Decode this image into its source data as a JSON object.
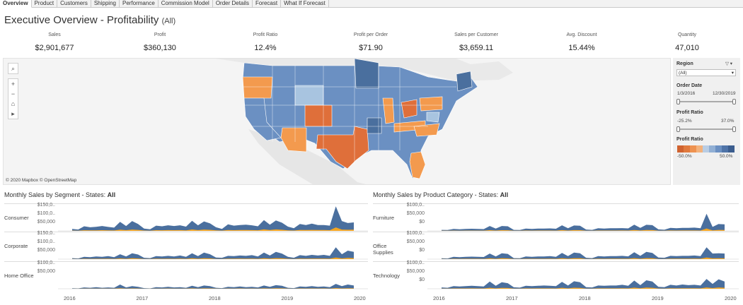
{
  "tabs": [
    {
      "label": "Overview",
      "active": true
    },
    {
      "label": "Product"
    },
    {
      "label": "Customers"
    },
    {
      "label": "Shipping"
    },
    {
      "label": "Performance"
    },
    {
      "label": "Commission Model"
    },
    {
      "label": "Order Details"
    },
    {
      "label": "Forecast"
    },
    {
      "label": "What If Forecast"
    }
  ],
  "title": "Executive Overview - Profitability",
  "title_filter": "(All)",
  "kpis": [
    {
      "label": "Sales",
      "value": "$2,901,677"
    },
    {
      "label": "Profit",
      "value": "$360,130"
    },
    {
      "label": "Profit Ratio",
      "value": "12.4%"
    },
    {
      "label": "Profit per Order",
      "value": "$71.90"
    },
    {
      "label": "Sales per Customer",
      "value": "$3,659.11"
    },
    {
      "label": "Avg. Discount",
      "value": "15.44%"
    },
    {
      "label": "Quantity",
      "value": "47,010"
    }
  ],
  "map": {
    "attribution": "© 2020 Mapbox  © OpenStreetMap",
    "controls": [
      "search-icon",
      "zoom-in-icon",
      "zoom-out-icon",
      "home-icon",
      "play-icon"
    ],
    "colors": {
      "blue_dark": "#4a6f9e",
      "blue": "#6b90c2",
      "blue_light": "#a8c4e0",
      "orange": "#f39a4e",
      "orange_dark": "#df6f3a"
    }
  },
  "filters": {
    "region_label": "Region",
    "region_value": "(All)",
    "order_date_label": "Order Date",
    "order_date_start": "1/3/2016",
    "order_date_end": "12/30/2019",
    "profit_ratio_label": "Profit Ratio",
    "profit_ratio_min": "-25.2%",
    "profit_ratio_max": "37.0%",
    "legend_label": "Profit Ratio",
    "legend_min": "-50.0%",
    "legend_max": "50.0%",
    "legend_colors": [
      "#d0622f",
      "#e07a3e",
      "#ee9250",
      "#f3b27c",
      "#b9cde4",
      "#91afd4",
      "#6b90c2",
      "#4f74a8",
      "#3b5d8e"
    ]
  },
  "charts": {
    "left_title": "Monthly Sales by Segment - States: ",
    "left_title_bold": "All",
    "right_title": "Monthly Sales by Product Category - States: ",
    "right_title_bold": "All",
    "sales_color": "#4a6f9e",
    "profit_color": "#f5a623",
    "years": [
      "2016",
      "2017",
      "2018",
      "2019",
      "2020"
    ],
    "left_rows": [
      {
        "label": "Consumer",
        "ticks": [
          "$150,0..",
          "$100,0..",
          "$50,000"
        ]
      },
      {
        "label": "Corporate",
        "ticks": [
          "$150,0..",
          "$100,0..",
          "$50,000"
        ]
      },
      {
        "label": "Home Office",
        "ticks": [
          "$100,0..",
          "$50,000"
        ]
      }
    ],
    "right_rows": [
      {
        "label": "Furniture",
        "ticks": [
          "$100,0..",
          "$50,000",
          "$0"
        ]
      },
      {
        "label": "Office Supplies",
        "ticks": [
          "$100,0..",
          "$50,000",
          "$0"
        ]
      },
      {
        "label": "Technology",
        "ticks": [
          "$100,0..",
          "$50,000",
          "$0"
        ]
      }
    ]
  },
  "chart_data": [
    {
      "type": "area",
      "title": "Monthly Sales by Segment - States: All",
      "x": [
        "2016",
        "2016",
        "2016",
        "2016",
        "2016",
        "2016",
        "2016",
        "2016",
        "2016",
        "2016",
        "2016",
        "2016",
        "2017",
        "2017",
        "2017",
        "2017",
        "2017",
        "2017",
        "2017",
        "2017",
        "2017",
        "2017",
        "2017",
        "2017",
        "2018",
        "2018",
        "2018",
        "2018",
        "2018",
        "2018",
        "2018",
        "2018",
        "2018",
        "2018",
        "2018",
        "2018",
        "2019",
        "2019",
        "2019",
        "2019",
        "2019",
        "2019",
        "2019",
        "2019",
        "2019",
        "2019",
        "2019",
        "2019"
      ],
      "series": [
        {
          "name": "Consumer",
          "values": [
            12000,
            8000,
            28000,
            22000,
            25000,
            30000,
            24000,
            20000,
            55000,
            30000,
            60000,
            42000,
            14000,
            10000,
            32000,
            28000,
            34000,
            30000,
            34000,
            26000,
            62000,
            34000,
            58000,
            46000,
            22000,
            12000,
            40000,
            32000,
            36000,
            38000,
            34000,
            28000,
            66000,
            38000,
            64000,
            50000,
            26000,
            16000,
            42000,
            36000,
            44000,
            36000,
            36000,
            32000,
            150000,
            60000,
            48000,
            52000
          ]
        },
        {
          "name": "Corporate",
          "values": [
            6000,
            4000,
            14000,
            12000,
            16000,
            14000,
            18000,
            12000,
            30000,
            16000,
            36000,
            28000,
            8000,
            6000,
            18000,
            16000,
            20000,
            16000,
            22000,
            14000,
            36000,
            18000,
            40000,
            30000,
            10000,
            8000,
            20000,
            18000,
            22000,
            20000,
            24000,
            16000,
            40000,
            22000,
            44000,
            34000,
            14000,
            8000,
            24000,
            20000,
            26000,
            22000,
            26000,
            20000,
            72000,
            30000,
            52000,
            44000
          ]
        },
        {
          "name": "Home Office",
          "values": [
            3000,
            2000,
            8000,
            6000,
            10000,
            6000,
            8000,
            6000,
            26000,
            8000,
            16000,
            12000,
            4000,
            2000,
            10000,
            8000,
            12000,
            8000,
            10000,
            6000,
            18000,
            10000,
            20000,
            16000,
            6000,
            4000,
            12000,
            10000,
            14000,
            10000,
            12000,
            8000,
            20000,
            12000,
            22000,
            18000,
            6000,
            4000,
            14000,
            12000,
            16000,
            12000,
            14000,
            10000,
            30000,
            16000,
            26000,
            20000
          ]
        }
      ],
      "ylabel": "Sales"
    },
    {
      "type": "area",
      "title": "Monthly Sales by Product Category - States: All",
      "x": [
        "2016",
        "2016",
        "2016",
        "2016",
        "2016",
        "2016",
        "2016",
        "2016",
        "2016",
        "2016",
        "2016",
        "2016",
        "2017",
        "2017",
        "2017",
        "2017",
        "2017",
        "2017",
        "2017",
        "2017",
        "2017",
        "2017",
        "2017",
        "2017",
        "2018",
        "2018",
        "2018",
        "2018",
        "2018",
        "2018",
        "2018",
        "2018",
        "2018",
        "2018",
        "2018",
        "2018",
        "2019",
        "2019",
        "2019",
        "2019",
        "2019",
        "2019",
        "2019",
        "2019",
        "2019",
        "2019",
        "2019",
        "2019"
      ],
      "series": [
        {
          "name": "Furniture",
          "values": [
            6000,
            5000,
            12000,
            10000,
            12000,
            13000,
            12000,
            11000,
            30000,
            14000,
            30000,
            28000,
            6000,
            5000,
            14000,
            12000,
            14000,
            14000,
            15000,
            13000,
            34000,
            16000,
            33000,
            31000,
            8000,
            6000,
            16000,
            14000,
            16000,
            16000,
            17000,
            15000,
            38000,
            18000,
            37000,
            35000,
            9000,
            7000,
            18000,
            16000,
            18000,
            18000,
            20000,
            16000,
            105000,
            24000,
            42000,
            40000
          ]
        },
        {
          "name": "Office Supplies",
          "values": [
            5000,
            4000,
            14000,
            12000,
            14000,
            15000,
            14000,
            13000,
            34000,
            16000,
            36000,
            32000,
            6000,
            5000,
            16000,
            14000,
            16000,
            16000,
            18000,
            14000,
            38000,
            18000,
            40000,
            36000,
            8000,
            6000,
            18000,
            16000,
            18000,
            18000,
            20000,
            17000,
            42000,
            20000,
            44000,
            38000,
            10000,
            8000,
            20000,
            18000,
            20000,
            20000,
            22000,
            18000,
            72000,
            34000,
            36000,
            34000
          ]
        },
        {
          "name": "Technology",
          "values": [
            8000,
            6000,
            16000,
            14000,
            16000,
            18000,
            16000,
            14000,
            44000,
            18000,
            40000,
            34000,
            9000,
            7000,
            18000,
            16000,
            18000,
            20000,
            18000,
            16000,
            42000,
            20000,
            46000,
            40000,
            10000,
            8000,
            20000,
            18000,
            20000,
            20000,
            24000,
            18000,
            50000,
            22000,
            52000,
            44000,
            12000,
            10000,
            24000,
            20000,
            26000,
            22000,
            24000,
            20000,
            60000,
            30000,
            58000,
            44000
          ]
        }
      ],
      "ylabel": "Sales"
    }
  ]
}
